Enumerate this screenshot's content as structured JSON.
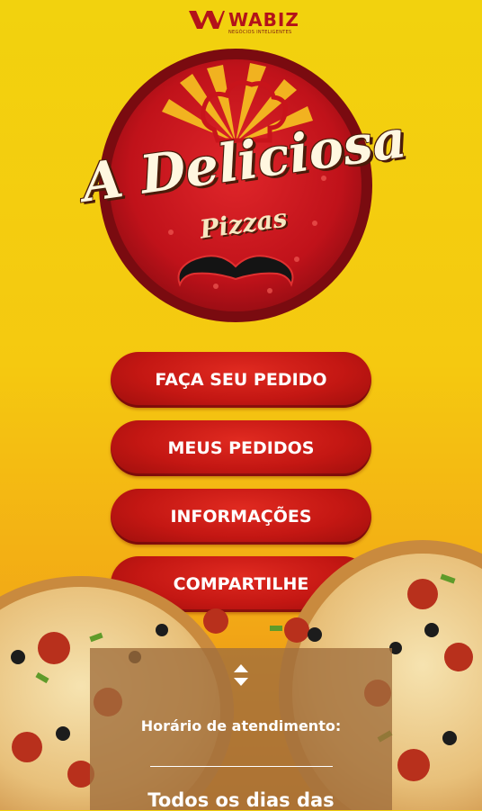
{
  "brand": {
    "name": "WABIZ",
    "tagline": "NEGÓCIOS INTELIGENTES",
    "icon": "wabiz-logo-icon"
  },
  "logo": {
    "title": "A Deliciosa",
    "subtitle": "Pizzas",
    "colors": {
      "disc": "#c8141b",
      "rim": "#8e0c12",
      "text": "#fff7e0",
      "mustache": "#111111"
    }
  },
  "menu": {
    "items": [
      {
        "label": "FAÇA SEU PEDIDO"
      },
      {
        "label": "MEUS PEDIDOS"
      },
      {
        "label": "INFORMAÇÕES"
      },
      {
        "label": "COMPARTILHE"
      }
    ]
  },
  "hours": {
    "label": "Horário de atendimento:",
    "days": "Todos os dias das"
  },
  "colors": {
    "background_top": "#f2d20e",
    "background_bottom": "#d9831a",
    "button": "#c41713"
  }
}
